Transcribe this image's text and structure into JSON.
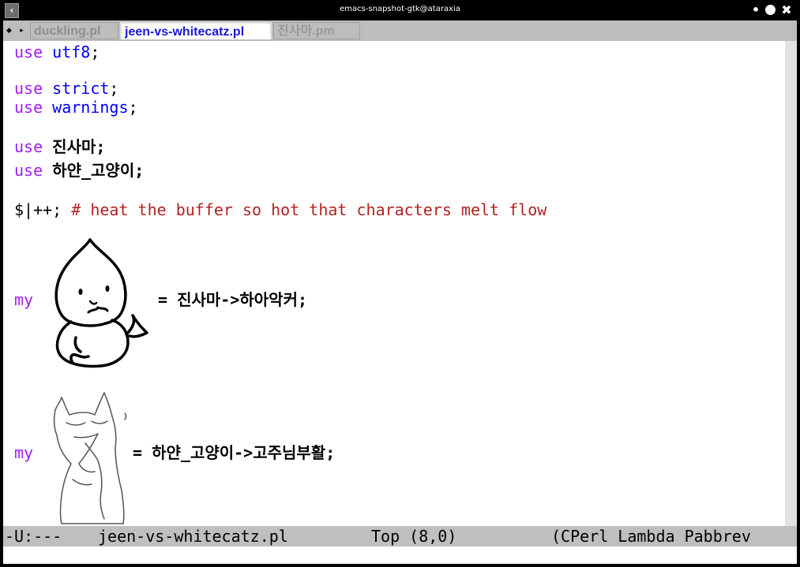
{
  "window": {
    "title": "emacs-snapshot-gtk@ataraxia",
    "app_icon": "emacs-window-icon",
    "controls": [
      "minimize",
      "maximize",
      "close"
    ]
  },
  "tabs": {
    "scroll_left": "◆",
    "scroll_right": "▸",
    "items": [
      {
        "label": "duckling.pl",
        "active": false
      },
      {
        "label": "jeen-vs-whitecatz.pl",
        "active": true
      },
      {
        "label": "진사마.pm",
        "active": false
      }
    ]
  },
  "code": {
    "line1": {
      "kw": "use",
      "pkg": "utf8",
      "end": ";"
    },
    "line2": {
      "kw": "use",
      "pkg": "strict",
      "end": ";"
    },
    "line3": {
      "kw": "use",
      "pkg": "warnings",
      "end": ";"
    },
    "line4": {
      "kw": "use",
      "rest": "진사마;"
    },
    "line5": {
      "kw": "use",
      "rest": "하얀_고양이;"
    },
    "line6": {
      "code": "$|++; ",
      "comment": "# heat the buffer so hot that characters melt flow"
    },
    "line7": {
      "kw": "my",
      "rhs": "= 진사마->하아악커;"
    },
    "line8": {
      "kw": "my",
      "rhs": "= 하얀_고양이->고주님부활;"
    }
  },
  "modeline": {
    "status": "-U:---",
    "buffer": "jeen-vs-whitecatz.pl",
    "position": "Top (8,0)",
    "modes": "(CPerl Lambda Pabbrev"
  },
  "colors": {
    "keyword": "#a020f0",
    "package": "#0000ff",
    "comment": "#b22222",
    "active_tab": "#1a1ad8",
    "modeline_bg": "#bfbfbf"
  }
}
